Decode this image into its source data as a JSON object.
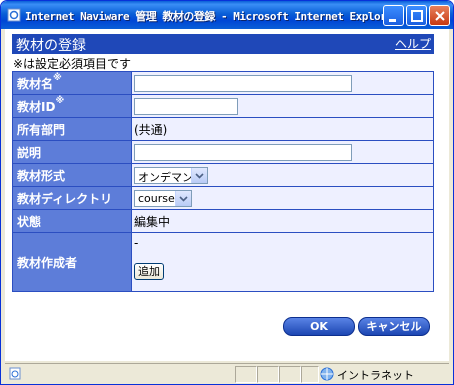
{
  "window": {
    "title": "Internet Naviware 管理 教材の登録 - Microsoft Internet Explorer"
  },
  "header": {
    "title": "教材の登録",
    "help_link": "ヘルプ"
  },
  "note": "※は設定必須項目です",
  "form": {
    "name_label": "教材名",
    "id_label": "教材ID",
    "required_mark": "※",
    "dept_label": "所有部門",
    "dept_value": "(共通)",
    "desc_label": "説明",
    "format_label": "教材形式",
    "format_value": "オンデマンド",
    "dir_label": "教材ディレクトリ",
    "dir_value": "course",
    "status_label": "状態",
    "status_value": "編集中",
    "author_label": "教材作成者",
    "author_value": "-",
    "add_button": "追加"
  },
  "buttons": {
    "ok": "OK",
    "cancel": "キャンセル"
  },
  "statusbar": {
    "zone": "イントラネット"
  },
  "colors": {
    "header_bar": "#1f48b8",
    "label_cell": "#5d7dd9",
    "value_cell": "#eef0ff"
  }
}
